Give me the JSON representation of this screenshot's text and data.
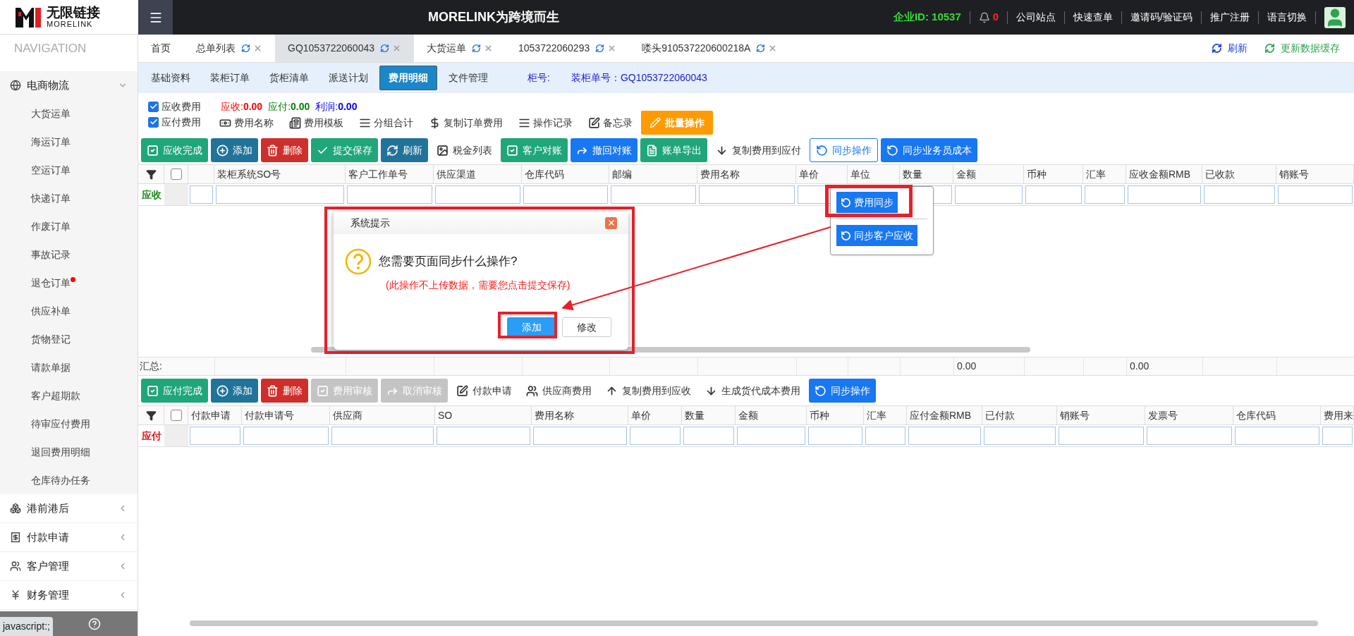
{
  "header": {
    "brand_cn": "无限链接",
    "brand_en": "MORELINK",
    "slogan": "MORELINK为跨境而生",
    "company_label": "企业ID:",
    "company_id": "10537",
    "notifications": "0",
    "links": [
      "公司站点",
      "快速查单",
      "邀请码/验证码",
      "推广注册",
      "语言切换"
    ]
  },
  "sidebar": {
    "title": "NAVIGATION",
    "groups": [
      {
        "label": "电商物流",
        "expanded": true,
        "children": [
          {
            "label": "大货运单",
            "dot": false
          },
          {
            "label": "海运订单",
            "dot": false
          },
          {
            "label": "空运订单",
            "dot": false
          },
          {
            "label": "快递订单",
            "dot": false
          },
          {
            "label": "作废订单",
            "dot": false
          },
          {
            "label": "事故记录",
            "dot": false
          },
          {
            "label": "退仓订单",
            "dot": true
          },
          {
            "label": "供应补单",
            "dot": false
          },
          {
            "label": "货物登记",
            "dot": false
          },
          {
            "label": "请款单据",
            "dot": false
          },
          {
            "label": "客户超期款",
            "dot": false
          },
          {
            "label": "待审应付费用",
            "dot": false
          },
          {
            "label": "退回费用明细",
            "dot": false
          },
          {
            "label": "仓库待办任务",
            "dot": false
          }
        ]
      },
      {
        "label": "港前港后",
        "expanded": false
      },
      {
        "label": "付款申请",
        "expanded": false
      },
      {
        "label": "客户管理",
        "expanded": false
      },
      {
        "label": "财务管理",
        "expanded": false
      }
    ],
    "status_bar": "javascript:;"
  },
  "tabs": [
    {
      "label": "首页",
      "selected": false,
      "closable": false
    },
    {
      "label": "总单列表",
      "selected": false,
      "closable": true
    },
    {
      "label": "GQ1053722060043",
      "selected": true,
      "closable": true
    },
    {
      "label": "大货运单",
      "selected": false,
      "closable": true
    },
    {
      "label": "1053722060293",
      "selected": false,
      "closable": true
    },
    {
      "label": "喽头910537220600218A",
      "selected": false,
      "closable": true
    }
  ],
  "tab_actions": [
    {
      "label": "刷新",
      "color": "#1a3fd6"
    },
    {
      "label": "更新数据缓存",
      "color": "#2ea44f"
    }
  ],
  "subtabs": [
    {
      "label": "基础资料",
      "selected": false
    },
    {
      "label": "装柜订单",
      "selected": false
    },
    {
      "label": "货柜清单",
      "selected": false
    },
    {
      "label": "派送计划",
      "selected": false
    },
    {
      "label": "费用明细",
      "selected": true
    },
    {
      "label": "文件管理",
      "selected": false
    }
  ],
  "container_label": "柜号:",
  "load_number": "装柜单号：GQ1053722060043",
  "fee_toggles": [
    {
      "label": "应收费用",
      "checked": true
    },
    {
      "label": "应付费用",
      "checked": true
    }
  ],
  "amounts": [
    {
      "label": "应收:",
      "value": "0.00",
      "color": "#ff0000"
    },
    {
      "label": "应付:",
      "value": "0.00",
      "color": "#008000"
    },
    {
      "label": "利润:",
      "value": "0.00",
      "color": "#0000ff"
    }
  ],
  "tools": [
    "费用名称",
    "费用模板",
    "分组合计",
    "复制订单费用",
    "操作记录",
    "备忘录"
  ],
  "batch_button": "批量操作",
  "receivable_toolbar": [
    {
      "label": "应收完成",
      "kind": "green"
    },
    {
      "label": "添加",
      "kind": "teal"
    },
    {
      "label": "删除",
      "kind": "red"
    },
    {
      "label": "提交保存",
      "kind": "green"
    },
    {
      "label": "刷新",
      "kind": "teal"
    },
    {
      "label": "税金列表",
      "kind": "plain"
    },
    {
      "label": "客户对账",
      "kind": "green"
    },
    {
      "label": "撤回对账",
      "kind": "blue"
    },
    {
      "label": "账单导出",
      "kind": "green"
    },
    {
      "label": "复制费用到应付",
      "kind": "plain"
    },
    {
      "label": "同步操作",
      "kind": "outline"
    },
    {
      "label": "同步业务员成本",
      "kind": "blue"
    }
  ],
  "receivable_table": {
    "select_all": {
      "checked": false
    },
    "row_label": "应收",
    "columns": [
      "装柜系统SO号",
      "客户工作单号",
      "供应渠道",
      "仓库代码",
      "邮编",
      "费用名称",
      "单价",
      "单位",
      "数量",
      "金额",
      "币种",
      "汇率",
      "应收金额RMB",
      "已收款",
      "销账号"
    ],
    "summary": {
      "label": "汇总:",
      "amount": "0.00",
      "amount_rmb": "0.00"
    }
  },
  "payable_toolbar": [
    {
      "label": "应付完成",
      "kind": "green",
      "disabled": false
    },
    {
      "label": "添加",
      "kind": "teal",
      "disabled": false
    },
    {
      "label": "删除",
      "kind": "red",
      "disabled": false
    },
    {
      "label": "费用审核",
      "kind": "grey",
      "disabled": true
    },
    {
      "label": "取消审核",
      "kind": "grey",
      "disabled": true
    },
    {
      "label": "付款申请",
      "kind": "plain",
      "disabled": false
    },
    {
      "label": "供应商费用",
      "kind": "plain",
      "disabled": false
    },
    {
      "label": "复制费用到应收",
      "kind": "plain",
      "disabled": false
    },
    {
      "label": "生成货代成本费用",
      "kind": "plain",
      "disabled": false
    },
    {
      "label": "同步操作",
      "kind": "blue",
      "disabled": false
    }
  ],
  "payable_table": {
    "select_all": {
      "checked": false
    },
    "row_label": "应付",
    "columns": [
      "付款申请",
      "付款申请号",
      "供应商",
      "SO",
      "费用名称",
      "单价",
      "数量",
      "金额",
      "币种",
      "汇率",
      "应付金额RMB",
      "已付款",
      "销账号",
      "发票号",
      "仓库代码",
      "费用来"
    ]
  },
  "sync_menu": {
    "items": [
      "费用同步",
      "同步客户应收"
    ]
  },
  "dialog": {
    "title": "系统提示",
    "message": "您需要页面同步什么操作?",
    "note": "(此操作不上传数据，需要您点击提交保存)",
    "buttons": [
      {
        "label": "添加",
        "kind": "primary"
      },
      {
        "label": "修改",
        "kind": "default"
      }
    ]
  }
}
